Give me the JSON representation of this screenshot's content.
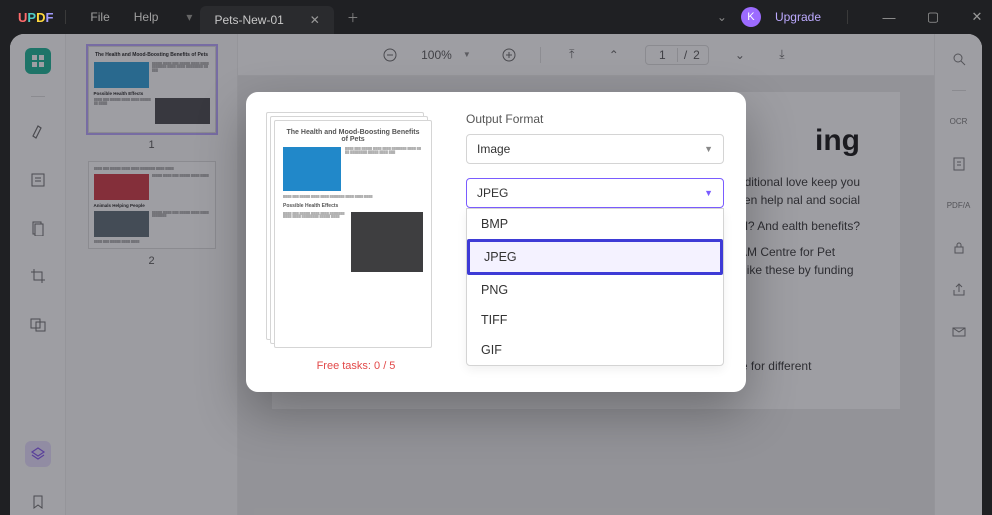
{
  "titlebar": {
    "logo": {
      "u": "U",
      "p": "P",
      "d": "D",
      "f": "F"
    },
    "menu": {
      "file": "File",
      "help": "Help"
    },
    "tab": {
      "title": "Pets-New-01"
    },
    "user_initial": "K",
    "upgrade": "Upgrade"
  },
  "toolbar": {
    "zoom_pct": "100%",
    "page_current": "1",
    "page_total": "2"
  },
  "thumbnails": {
    "p1_num": "1",
    "p2_num": "2",
    "doc_title": "The Health and Mood-Boosting Benefits of Pets",
    "sub1": "Possible Health Effects",
    "sub2": "Animals Helping People"
  },
  "document": {
    "title_tail": "ing",
    "p1": "py of coming home unconditional love keep you ecrease stress, even help nal and social",
    "p2": "households have m an animal? And ealth benefits?",
    "p3": "NIH has orporation's WALTHAM Centre for Pet Nutrition to answer  questions  like these by funding research studies.",
    "p4": "Scientists are looking at what the potential physical and mental health benefits are for different"
  },
  "modal": {
    "free_tasks": "Free tasks: 0 / 5",
    "output_format_label": "Output Format",
    "output_format_value": "Image",
    "image_format_value": "JPEG",
    "options": {
      "bmp": "BMP",
      "jpeg": "JPEG",
      "png": "PNG",
      "tiff": "TIFF",
      "gif": "GIF"
    },
    "preview_title": "The Health and Mood-Boosting Benefits of Pets",
    "preview_sub": "Possible Health Effects"
  }
}
